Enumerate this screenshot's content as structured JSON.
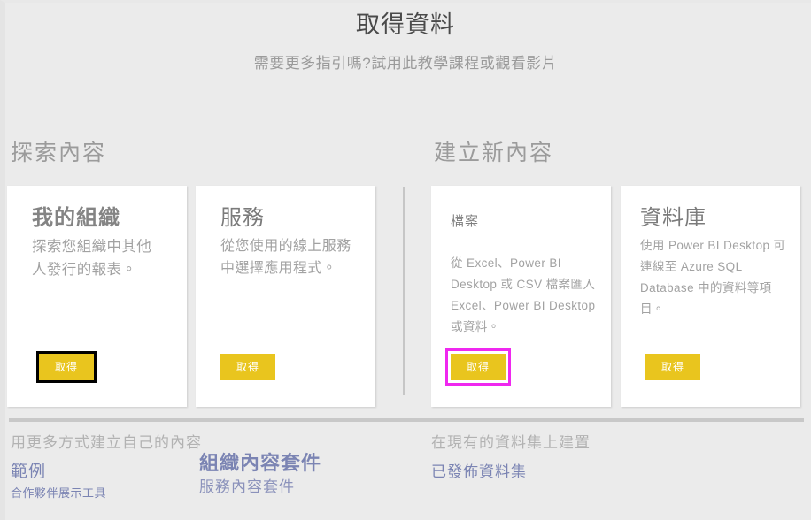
{
  "header": {
    "title": "取得資料",
    "subtitle": "需要更多指引嗎?試用此教學課程或觀看影片"
  },
  "sections": {
    "explore_heading": "探索內容",
    "create_heading": "建立新內容"
  },
  "cards": [
    {
      "id": "my-organization",
      "title": "我的組織",
      "description": "探索您組織中其他人發行的報表。",
      "button_label": "取得",
      "button_state": "focused-black-outline"
    },
    {
      "id": "services",
      "title": "服務",
      "description": "從您使用的線上服務中選擇應用程式。",
      "button_label": "取得",
      "button_state": "normal"
    },
    {
      "id": "files",
      "title": "檔案",
      "description": "從 Excel、Power BI Desktop 或 CSV 檔案匯入 Excel、Power BI Desktop 或資料。",
      "button_label": "取得",
      "button_state": "highlighted-magenta-outline"
    },
    {
      "id": "databases",
      "title": "資料庫",
      "description": "使用 Power BI Desktop 可連線至 Azure SQL Database 中的資料等項目。",
      "button_label": "取得",
      "button_state": "normal"
    }
  ],
  "footer": {
    "left_heading": "用更多方式建立自己的內容",
    "samples_link": "範例",
    "partner_showcase_link": "合作夥伴展示工具",
    "org_content_packs_link": "組織內容套件",
    "service_content_packs_link": "服務內容套件",
    "right_heading": "在現有的資料集上建置",
    "published_datasets_link": "已發佈資料集"
  },
  "colors": {
    "accent_yellow": "#e9c51e",
    "highlight_magenta": "#ef28ef",
    "focus_black": "#000000",
    "link_blue": "#7b84b3",
    "page_background": "#ebebeb",
    "card_background": "#ffffff"
  }
}
